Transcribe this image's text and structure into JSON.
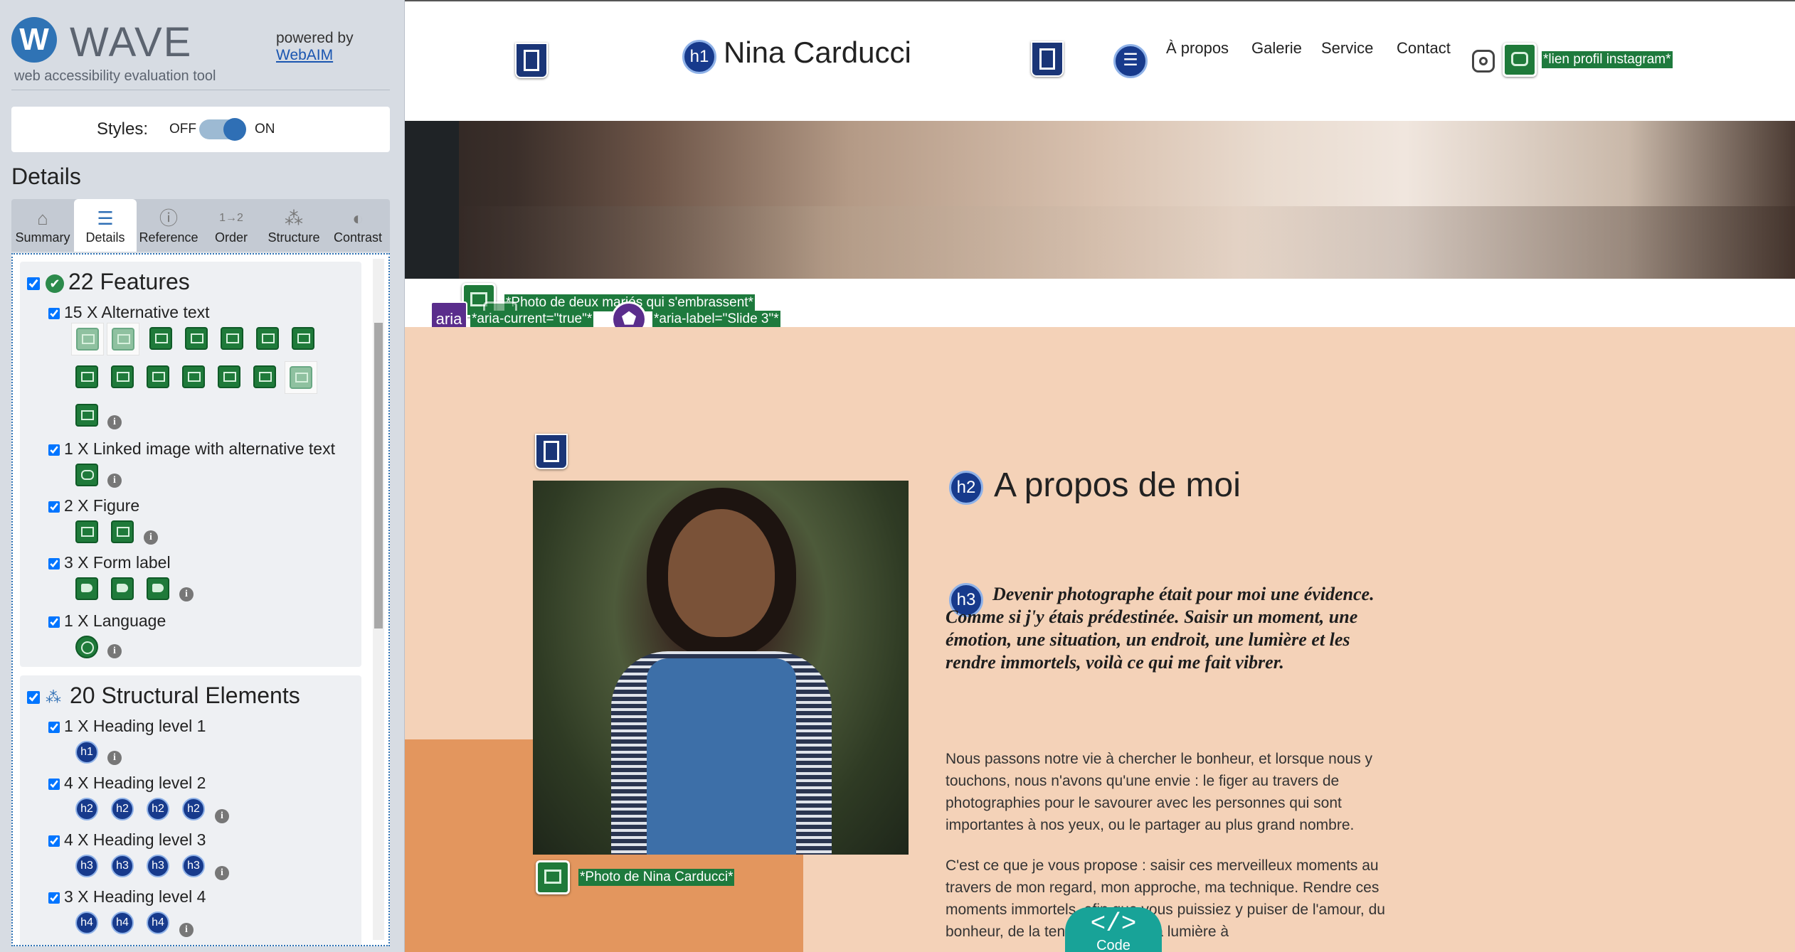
{
  "wave": {
    "logo_letter": "W",
    "logo_text": "WAVE",
    "logo_subtitle": "web accessibility evaluation tool",
    "powered_by": "powered by",
    "webaim_link": "WebAIM",
    "styles_label": "Styles:",
    "styles_off": "OFF",
    "styles_on": "ON",
    "details_title": "Details",
    "tabs": [
      {
        "label": "Summary",
        "icon": "home-icon"
      },
      {
        "label": "Details",
        "icon": "list-icon"
      },
      {
        "label": "Reference",
        "icon": "info-icon"
      },
      {
        "label": "Order",
        "icon": "order-icon"
      },
      {
        "label": "Structure",
        "icon": "structure-icon"
      },
      {
        "label": "Contrast",
        "icon": "contrast-icon"
      }
    ],
    "features": {
      "heading": "22 Features",
      "items": [
        {
          "label": "15 X Alternative text"
        },
        {
          "label": "1 X Linked image with alternative text"
        },
        {
          "label": "2 X Figure"
        },
        {
          "label": "3 X Form label"
        },
        {
          "label": "1 X Language"
        }
      ]
    },
    "structural": {
      "heading": "20 Structural Elements",
      "items": [
        {
          "label": "1 X Heading level 1",
          "badge": "h1"
        },
        {
          "label": "4 X Heading level 2",
          "badge": "h2"
        },
        {
          "label": "4 X Heading level 3",
          "badge": "h3"
        },
        {
          "label": "3 X Heading level 4",
          "badge": "h4"
        }
      ]
    }
  },
  "site": {
    "title": "Nina Carducci",
    "nav": [
      "À propos",
      "Galerie",
      "Service",
      "Contact"
    ],
    "instagram_alt": "*lien profil instagram*",
    "carousel_alt": "*Photo de deux mariés qui s'embrassent*",
    "aria_current": "*aria-current=\"true\"*",
    "aria_label": "*aria-label=\"Slide 3\"*",
    "about_heading": "A propos de moi",
    "about_h3": "Devenir photographe était pour moi une évidence. Comme si j'y étais prédestinée. Saisir un moment, une émotion, une situation, un endroit, une lumière et les rendre immortels, voilà ce qui me fait vibrer.",
    "para1": "Nous passons notre vie à chercher le bonheur, et lorsque nous y touchons, nous n'avons qu'une envie : le figer au travers de photographies pour le savourer avec les personnes qui sont importantes à nos yeux, ou le partager au plus grand nombre.",
    "para2": "C'est ce que je vous propose : saisir ces merveilleux moments au travers de mon regard, mon approche, ma technique. Rendre ces moments immortels, afin que vous puissiez y puiser de l'amour, du bonheur, de la tendresse et de la lumière à",
    "portrait_alt": "*Photo de Nina Carducci*",
    "code_button": "Code",
    "code_symbol": "</>",
    "h1_badge": "h1",
    "h2_badge": "h2",
    "h3_badge": "h3",
    "aria_badge": "aria"
  },
  "colors": {
    "wave_blue": "#2f73b5",
    "feature_green": "#1f7a3a",
    "heading_badge": "#173a8c",
    "aria_purple": "#5a2d8c",
    "peach": "#f4d2b8",
    "orange": "#e3965e",
    "code_teal": "#18a398"
  }
}
